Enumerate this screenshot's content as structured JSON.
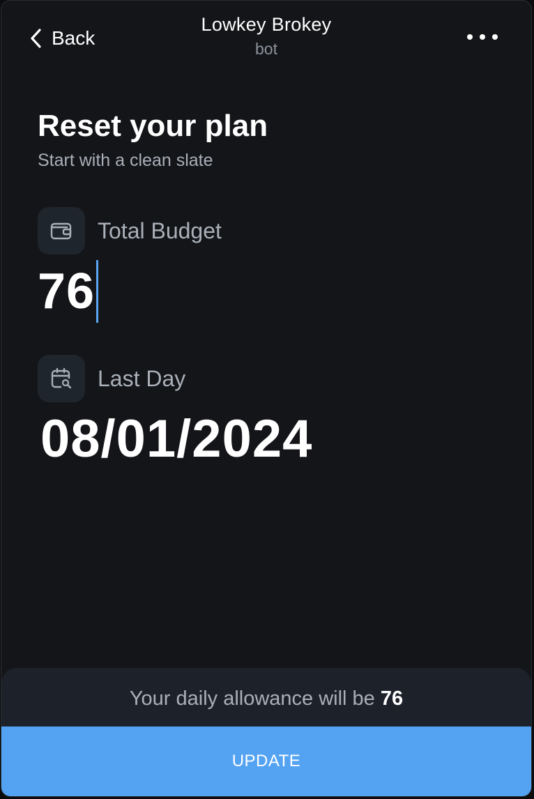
{
  "header": {
    "back_label": "Back",
    "title": "Lowkey Brokey",
    "subtitle": "bot"
  },
  "page": {
    "heading": "Reset your plan",
    "subheading": "Start with a clean slate"
  },
  "form": {
    "budget_label": "Total Budget",
    "budget_value": "76",
    "last_day_label": "Last Day",
    "last_day_value": "08/01/2024"
  },
  "footer": {
    "allowance_prefix": "Your daily allowance will be",
    "allowance_value": "76",
    "update_label": "UPDATE"
  },
  "icons": {
    "back": "chevron-left-icon",
    "more": "more-horizontal-icon",
    "budget": "wallet-icon",
    "last_day": "calendar-search-icon"
  },
  "colors": {
    "background": "#141518",
    "accent": "#54a3f3",
    "caret": "#5aa6f5",
    "panel": "#1d222a",
    "icon_box": "#1f252c"
  }
}
